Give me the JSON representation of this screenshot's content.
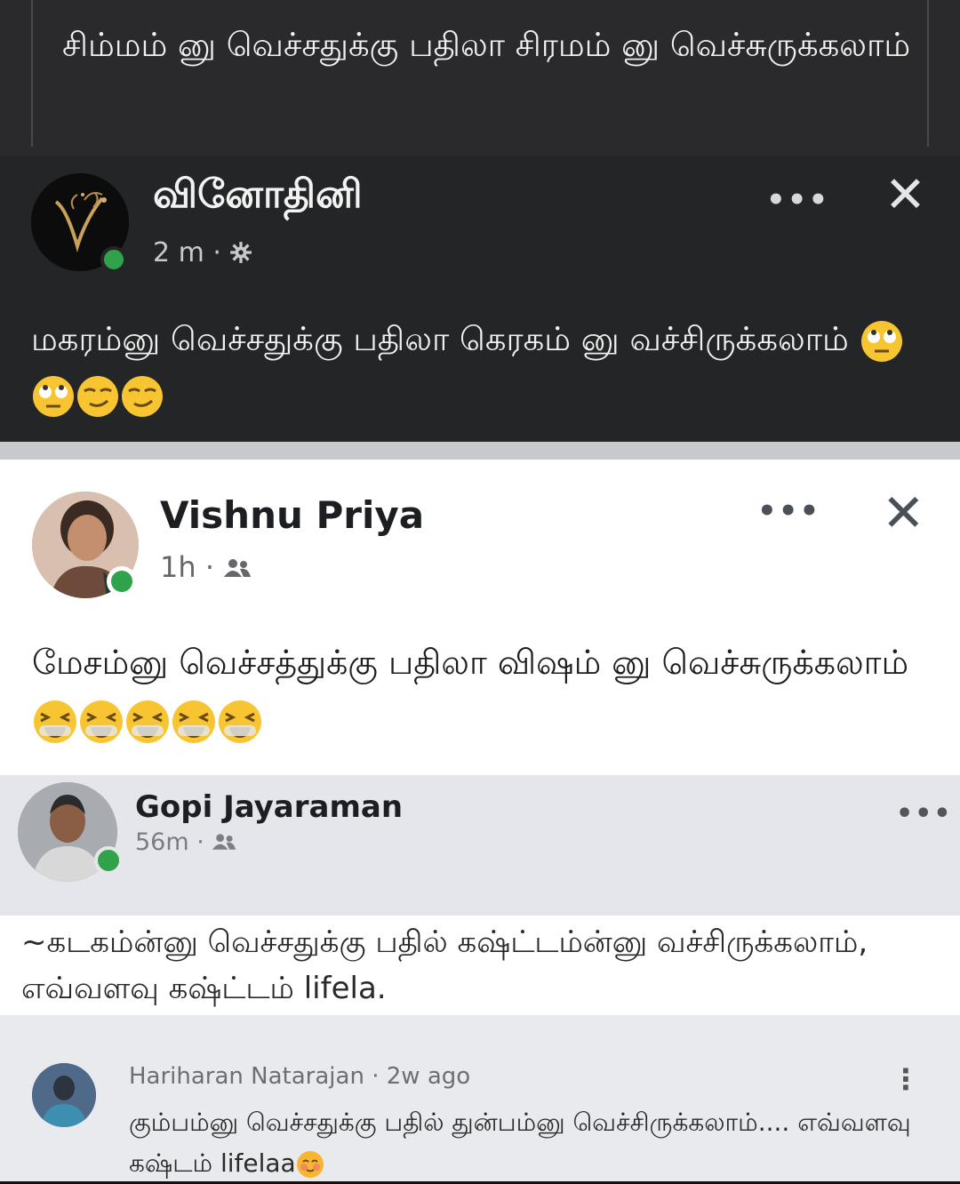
{
  "quote": {
    "text": "சிம்மம் னு வெச்சதுக்கு பதிலா சிரமம் னு வெச்சுருக்கலாம்"
  },
  "post_dark": {
    "author": "வினோதினி",
    "time": "2 m",
    "privacy_icon": "gear-icon",
    "body": "மகரம்னு வெச்சதுக்கு பதிலா கெரகம் னு வச்சிருக்கலாம்",
    "emojis": [
      "face-with-rolling-eyes",
      "face-with-rolling-eyes",
      "smirking-face",
      "smirking-face"
    ],
    "more_label": "•••",
    "close_label": "✕"
  },
  "post_light": {
    "author": "Vishnu Priya",
    "time": "1h",
    "privacy_icon": "friends-icon",
    "body": "மேசம்னு வெச்சத்துக்கு பதிலா விஷம் னு வெச்சுருக்கலாம்",
    "emojis": [
      "laughing-face",
      "laughing-face",
      "laughing-face",
      "laughing-face",
      "laughing-face"
    ],
    "more_label": "•••",
    "close_label": "✕"
  },
  "comment_1": {
    "author": "Gopi Jayaraman",
    "time": "56m",
    "privacy_icon": "friends-icon",
    "more_label": "•••",
    "body": "~கடகம்ன்னு வெச்சதுக்கு பதில் கஷ்ட்டம்ன்னு வச்சிருக்கலாம், எவ்வளவு கஷ்ட்டம் lifela."
  },
  "comment_2": {
    "author": "Hariharan Natarajan",
    "time": "2w ago",
    "body": "கும்பம்னு வெச்சதுக்கு பதில் துன்பம்னு வெச்சிருக்கலாம்.... எவ்வளவு கஷ்டம் lifelaa",
    "emoji": "blushing-face",
    "kebab_label": "⋮"
  },
  "colors": {
    "dark_bg": "#242526",
    "online_green": "#31a24c",
    "emoji_yellow": "#f7c531"
  }
}
